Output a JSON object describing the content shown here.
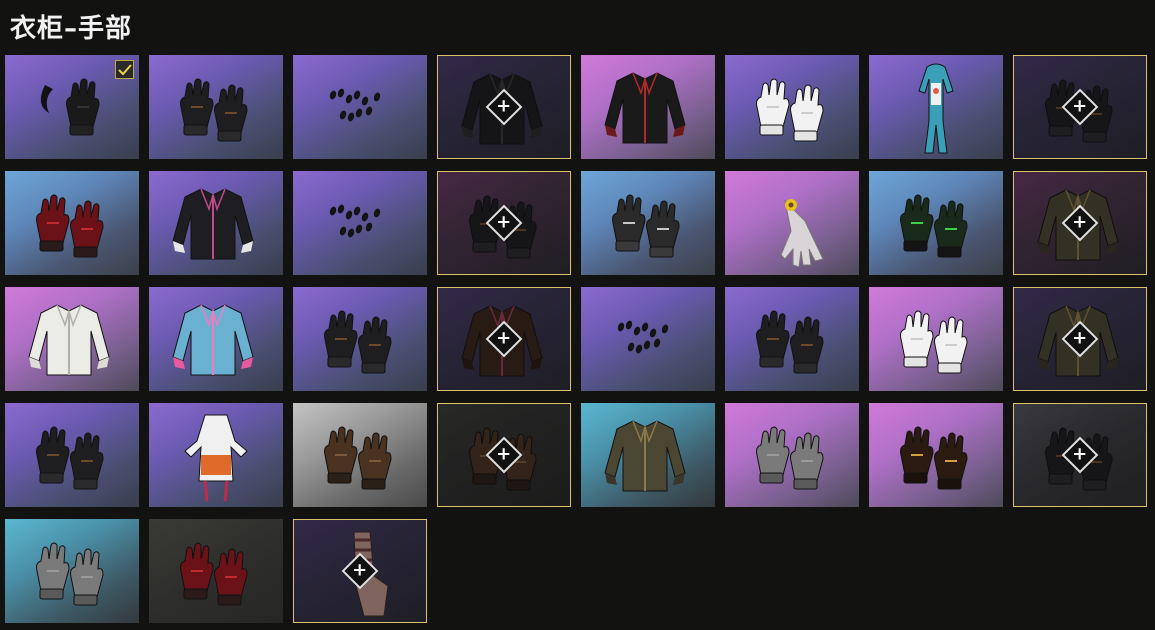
{
  "header": {
    "title": "衣柜–手部"
  },
  "colors": {
    "locked_border": "#d9c26a",
    "equipped_check": "#e8d44a",
    "page_background": "#121210"
  },
  "items": [
    {
      "name": "item-black-claw-gloves",
      "bg": "purple",
      "art": "claw",
      "locked": false,
      "equipped": true
    },
    {
      "name": "item-dark-patterned-gloves",
      "bg": "purple",
      "art": "glove-dark",
      "locked": false,
      "equipped": false
    },
    {
      "name": "item-tiny-accessories",
      "bg": "purple",
      "art": "bits",
      "locked": false,
      "equipped": false
    },
    {
      "name": "item-black-jacket",
      "bg": "dpurple",
      "art": "jacket",
      "locked": true,
      "equipped": false
    },
    {
      "name": "item-red-black-jacket",
      "bg": "pink",
      "art": "jacket-red",
      "locked": false,
      "equipped": false
    },
    {
      "name": "item-white-gloves",
      "bg": "purple",
      "art": "glove-white",
      "locked": false,
      "equipped": false
    },
    {
      "name": "item-blue-bodysuit",
      "bg": "purple",
      "art": "bodysuit",
      "locked": false,
      "equipped": false
    },
    {
      "name": "item-purple-dark-gloves",
      "bg": "dpurple",
      "art": "glove-dark",
      "locked": true,
      "equipped": false
    },
    {
      "name": "item-red-armored-gloves",
      "bg": "blue",
      "art": "glove-red",
      "locked": false,
      "equipped": false
    },
    {
      "name": "item-black-hoodie",
      "bg": "purple",
      "art": "hoodie",
      "locked": false,
      "equipped": false
    },
    {
      "name": "item-small-nails",
      "bg": "purple",
      "art": "bits",
      "locked": false,
      "equipped": false
    },
    {
      "name": "item-black-short-gloves",
      "bg": "dpink",
      "art": "glove-dark",
      "locked": true,
      "equipped": false
    },
    {
      "name": "item-mechanical-gloves",
      "bg": "blue",
      "art": "glove-mech",
      "locked": false,
      "equipped": false
    },
    {
      "name": "item-flower-bracelet-hand",
      "bg": "pink",
      "art": "hand-flower",
      "locked": false,
      "equipped": false
    },
    {
      "name": "item-green-racing-gloves",
      "bg": "blue",
      "art": "glove-green",
      "locked": false,
      "equipped": false
    },
    {
      "name": "item-camo-jacket",
      "bg": "dpink",
      "art": "jacket-camo",
      "locked": true,
      "equipped": false
    },
    {
      "name": "item-white-shirt",
      "bg": "pink",
      "art": "shirt-white",
      "locked": false,
      "equipped": false
    },
    {
      "name": "item-pink-crop-top",
      "bg": "purple",
      "art": "top-pink",
      "locked": false,
      "equipped": false
    },
    {
      "name": "item-black-leather-gloves",
      "bg": "purple",
      "art": "glove-dark",
      "locked": false,
      "equipped": false
    },
    {
      "name": "item-brown-coat",
      "bg": "dpurple",
      "art": "coat",
      "locked": true,
      "equipped": false
    },
    {
      "name": "item-black-nails-bracelet",
      "bg": "purple",
      "art": "bits",
      "locked": false,
      "equipped": false
    },
    {
      "name": "item-fingerless-gloves",
      "bg": "purple",
      "art": "glove-dark",
      "locked": false,
      "equipped": false
    },
    {
      "name": "item-white-riding-gloves",
      "bg": "pink",
      "art": "glove-white",
      "locked": false,
      "equipped": false
    },
    {
      "name": "item-camo-dress",
      "bg": "dpurple",
      "art": "jacket-camo",
      "locked": true,
      "equipped": false
    },
    {
      "name": "item-long-black-gloves",
      "bg": "purple",
      "art": "glove-dark",
      "locked": false,
      "equipped": false
    },
    {
      "name": "item-orange-costume",
      "bg": "purple",
      "art": "costume",
      "locked": false,
      "equipped": false
    },
    {
      "name": "item-brown-knit-gloves",
      "bg": "gray",
      "art": "glove-brown",
      "locked": false,
      "equipped": false
    },
    {
      "name": "item-brown-work-gloves",
      "bg": "dbrown",
      "art": "glove-brown",
      "locked": true,
      "equipped": false
    },
    {
      "name": "item-gold-camo-jacket",
      "bg": "teal",
      "art": "jacket-camo",
      "locked": false,
      "equipped": false
    },
    {
      "name": "item-gray-knit-gloves",
      "bg": "pink",
      "art": "glove-gray",
      "locked": false,
      "equipped": false
    },
    {
      "name": "item-gold-claw-gloves",
      "bg": "pink",
      "art": "glove-gold",
      "locked": false,
      "equipped": false
    },
    {
      "name": "item-dark-teal-gloves",
      "bg": "dark",
      "art": "glove-dark",
      "locked": true,
      "equipped": false
    },
    {
      "name": "item-gray-wool-mittens",
      "bg": "teal",
      "art": "glove-gray",
      "locked": false,
      "equipped": false
    },
    {
      "name": "item-red-moto-gloves",
      "bg": "dbrown",
      "art": "glove-red",
      "locked": false,
      "equipped": false
    },
    {
      "name": "item-bandaged-hand",
      "bg": "dpurple",
      "art": "hand-wrap",
      "locked": true,
      "equipped": false
    }
  ]
}
